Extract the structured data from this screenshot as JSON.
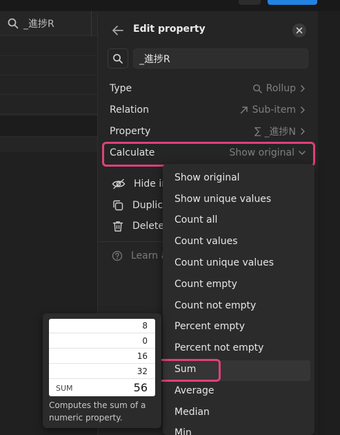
{
  "table": {
    "column_name": "_進捗R",
    "column_icon": "search-icon"
  },
  "panel": {
    "title": "Edit property",
    "property_name": "_進捗R",
    "rows": {
      "type": {
        "label": "Type",
        "value": "Rollup",
        "icon": "search-icon"
      },
      "relation": {
        "label": "Relation",
        "value": "Sub-item",
        "icon": "arrow-up-right-icon"
      },
      "property": {
        "label": "Property",
        "value": "_進捗N",
        "icon": "sigma-icon",
        "icon_glyph": "∑"
      },
      "calculate": {
        "label": "Calculate",
        "value": "Show original",
        "icon": "chevron-down-icon"
      }
    },
    "actions": {
      "hide": "Hide in",
      "duplicate": "Duplica",
      "delete": "Delete"
    },
    "learn": "Learn a"
  },
  "menu": {
    "items": [
      "Show original",
      "Show unique values",
      "Count all",
      "Count values",
      "Count unique values",
      "Count empty",
      "Count not empty",
      "Percent empty",
      "Percent not empty",
      "Sum",
      "Average",
      "Median",
      "Min"
    ],
    "selected": "Sum"
  },
  "tooltip": {
    "values": [
      "8",
      "0",
      "16",
      "32"
    ],
    "sum_label": "SUM",
    "sum_value": "56",
    "description": "Computes the sum of a numeric property."
  },
  "colors": {
    "highlight": "#e0407b",
    "accent_blue": "#2383e2"
  }
}
